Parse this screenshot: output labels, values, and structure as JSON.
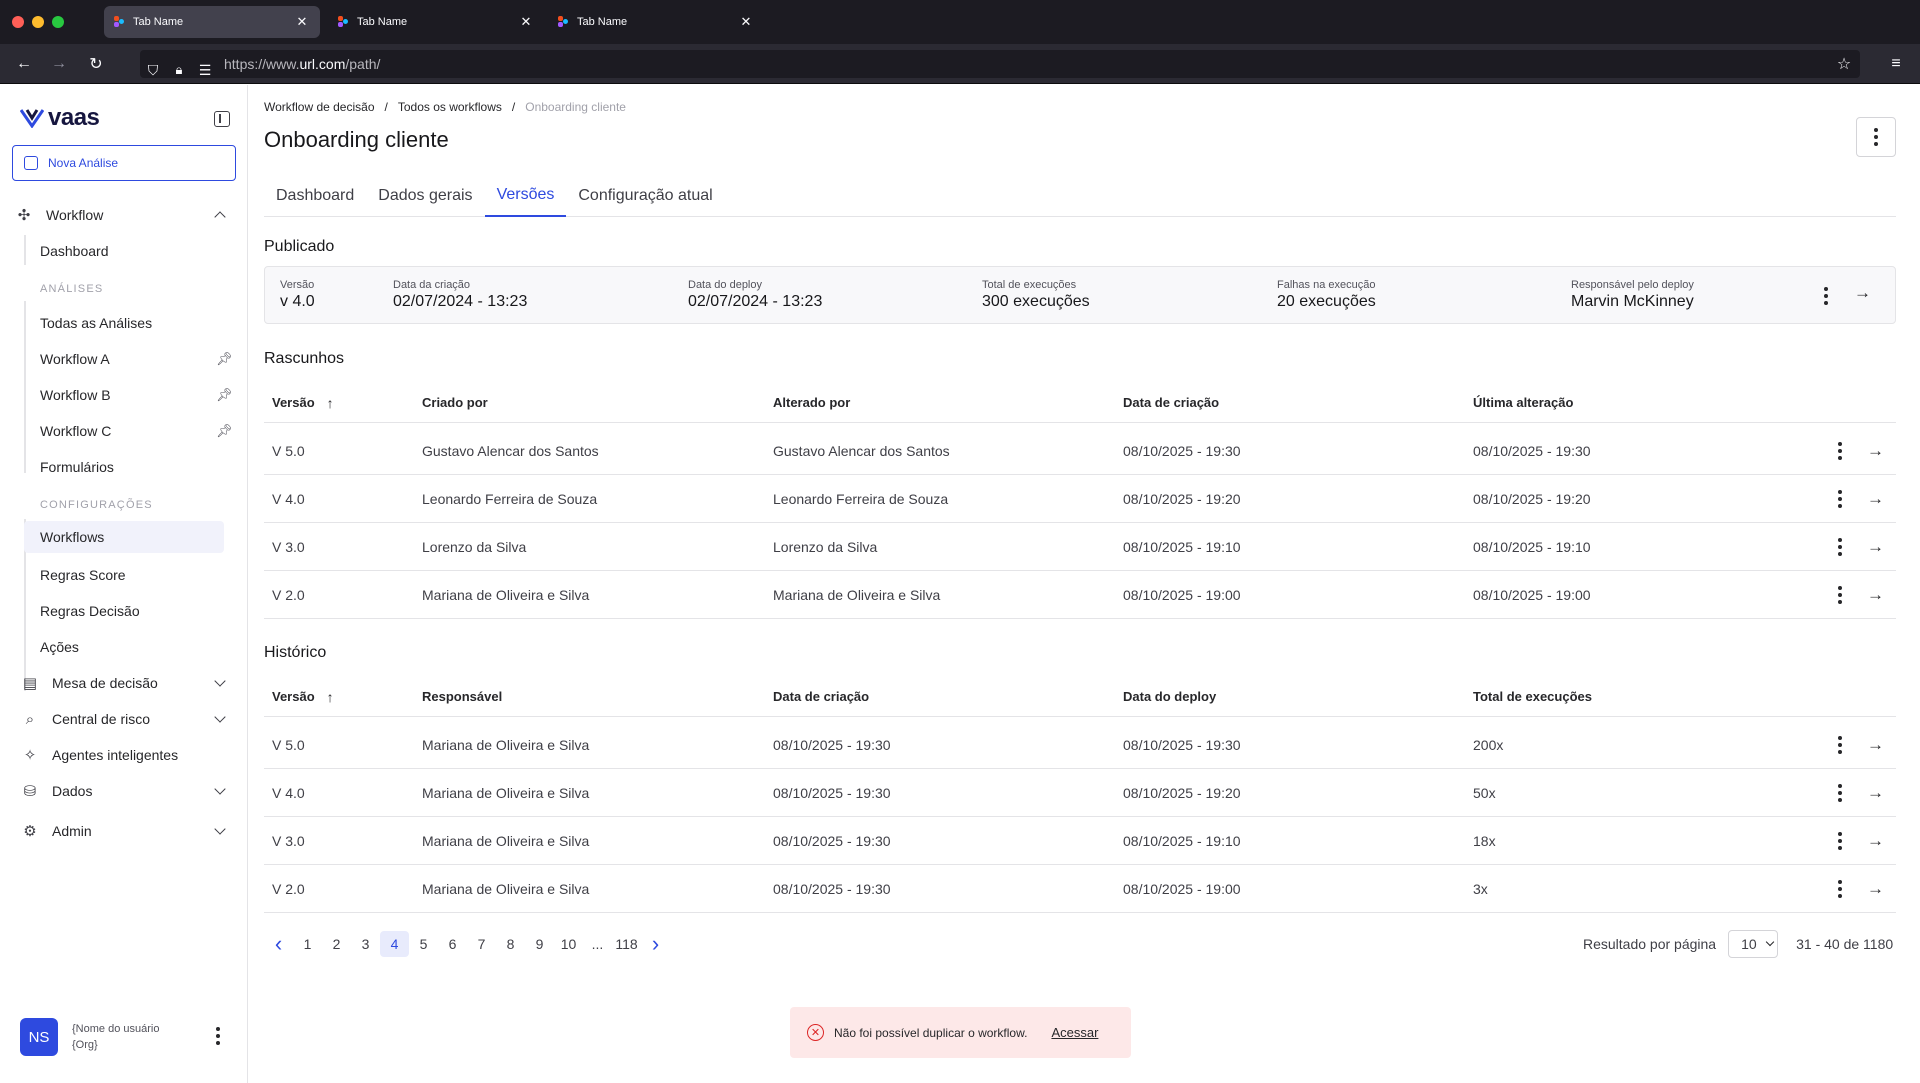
{
  "browser": {
    "tabs": [
      {
        "label": "Tab Name"
      },
      {
        "label": "Tab Name"
      },
      {
        "label": "Tab Name"
      }
    ],
    "url_prefix": "https://www.",
    "url_host": "url.com",
    "url_path": "/path/"
  },
  "sidebar": {
    "logo": "vaas",
    "new_analysis": "Nova Análise",
    "workflow_label": "Workflow",
    "dashboard": "Dashboard",
    "section_analises": "ANÁLISES",
    "todas": "Todas as Análises",
    "workflow_a": "Workflow A",
    "workflow_b": "Workflow B",
    "workflow_c": "Workflow C",
    "formularios": "Formulários",
    "section_config": "CONFIGURAÇÕES",
    "workflows": "Workflows",
    "regras_score": "Regras Score",
    "regras_decisao": "Regras Decisão",
    "acoes": "Ações",
    "mesa": "Mesa de decisão",
    "central": "Central de risco",
    "agentes": "Agentes inteligentes",
    "dados": "Dados",
    "admin": "Admin",
    "user_initials": "NS",
    "user_name": "{Nome do usuário",
    "user_org": "{Org}"
  },
  "main": {
    "breadcrumb": [
      "Workflow de decisão",
      "/",
      "Todos os workflows",
      "/",
      "Onboarding cliente"
    ],
    "title": "Onboarding cliente",
    "tabs": [
      "Dashboard",
      "Dados gerais",
      "Versões",
      "Configuração atual"
    ],
    "published": {
      "title": "Publicado",
      "fields": [
        {
          "label": "Versão",
          "value": "v 4.0"
        },
        {
          "label": "Data da criação",
          "value": "02/07/2024 - 13:23"
        },
        {
          "label": "Data do deploy",
          "value": "02/07/2024 - 13:23"
        },
        {
          "label": "Total de execuções",
          "value": "300 execuções"
        },
        {
          "label": "Falhas na execução",
          "value": "20 execuções"
        },
        {
          "label": "Responsável pelo deploy",
          "value": "Marvin McKinney"
        }
      ]
    },
    "drafts": {
      "title": "Rascunhos",
      "headers": [
        "Versão",
        "Criado por",
        "Alterado por",
        "Data de criação",
        "Última alteração"
      ],
      "sort_icon": "↑",
      "rows": [
        [
          "V 5.0",
          "Gustavo Alencar dos Santos",
          "Gustavo Alencar dos Santos",
          "08/10/2025 - 19:30",
          "08/10/2025 - 19:30"
        ],
        [
          "V 4.0",
          "Leonardo Ferreira de Souza",
          "Leonardo Ferreira de Souza",
          "08/10/2025 - 19:20",
          "08/10/2025 - 19:20"
        ],
        [
          "V 3.0",
          "Lorenzo da Silva",
          "Lorenzo da Silva",
          "08/10/2025 - 19:10",
          "08/10/2025 - 19:10"
        ],
        [
          "V 2.0",
          "Mariana de Oliveira e Silva",
          "Mariana de Oliveira e Silva",
          "08/10/2025 - 19:00",
          "08/10/2025 - 19:00"
        ]
      ]
    },
    "history": {
      "title": "Histórico",
      "headers": [
        "Versão",
        "Responsável",
        "Data de criação",
        "Data do deploy",
        "Total de execuções"
      ],
      "sort_icon": "↑",
      "rows": [
        [
          "V 5.0",
          "Mariana de Oliveira e Silva",
          "08/10/2025 - 19:30",
          "08/10/2025 - 19:30",
          "200x"
        ],
        [
          "V 4.0",
          "Mariana de Oliveira e Silva",
          "08/10/2025 - 19:30",
          "08/10/2025 - 19:20",
          "50x"
        ],
        [
          "V 3.0",
          "Mariana de Oliveira e Silva",
          "08/10/2025 - 19:30",
          "08/10/2025 - 19:10",
          "18x"
        ],
        [
          "V 2.0",
          "Mariana de Oliveira e Silva",
          "08/10/2025 - 19:30",
          "08/10/2025 - 19:00",
          "3x"
        ]
      ]
    },
    "pagination": {
      "pages": [
        "1",
        "2",
        "3",
        "4",
        "5",
        "6",
        "7",
        "8",
        "9",
        "10",
        "...",
        "118"
      ],
      "current": "4",
      "per_page_label": "Resultado por página",
      "per_page_value": "10",
      "range": "31 - 40 de 1180"
    },
    "toast": {
      "message": "Não foi possível duplicar o workflow.",
      "action": "Acessar"
    }
  }
}
